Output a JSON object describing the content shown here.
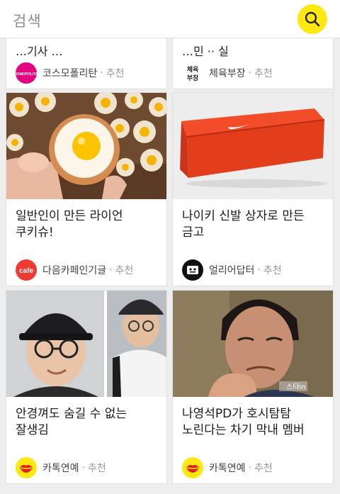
{
  "header": {
    "search_label": "검색",
    "search_icon": "search-icon",
    "accent": "#ffe812"
  },
  "cards": [
    {
      "title_fragment": "…기사 …",
      "source": "코스모폴리탄",
      "badge_text": "COSMOPOLITAN",
      "badge_color": "#e4007f",
      "recommend": "추천"
    },
    {
      "title_fragment": "…민 ·· 실",
      "source": "체육부장",
      "badge_text": "체육 부장",
      "badge_color": "#222222",
      "recommend": "추천"
    },
    {
      "title": "일반인이 만든 라이언 쿠키슈!",
      "source": "다음카페인기글",
      "badge_text": "cafe",
      "badge_color": "#ee3b32",
      "recommend": "추천",
      "image": "egg-cookie-photo"
    },
    {
      "title": "나이키 신발 상자로 만든 금고",
      "source": "얼리어답터",
      "badge_icon": "robot-face-icon",
      "badge_color": "#111111",
      "recommend": "추천",
      "image": "orange-shoebox-photo"
    },
    {
      "title": "안경껴도 숨길 수 없는 잘생김",
      "source": "카톡연예",
      "badge_icon": "lips-icon",
      "badge_color": "#ffe812",
      "recommend": "추천",
      "image": "glasses-idol-photo"
    },
    {
      "title": "나영석PD가 호시탐탐 노린다는 차기 막내 멤버",
      "source": "카톡연예",
      "badge_icon": "lips-icon",
      "badge_color": "#ffe812",
      "recommend": "추천",
      "image": "actor-portrait-photo",
      "watermark": "스타in"
    }
  ],
  "separator": "·"
}
